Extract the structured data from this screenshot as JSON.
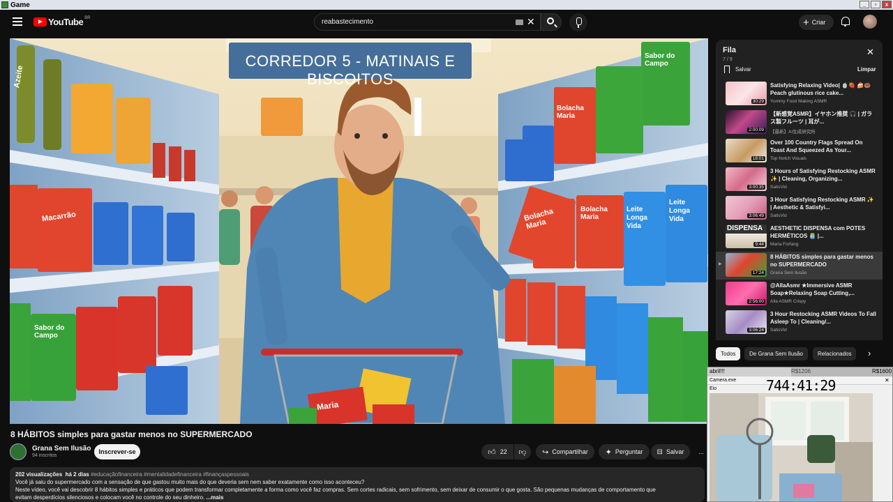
{
  "window": {
    "title": "Game"
  },
  "header": {
    "logo_text": "YouTube",
    "logo_region": "BR",
    "search_query": "reabastecimento",
    "create_label": "Criar",
    "icons": [
      "menu-icon",
      "search-icon",
      "mic-icon",
      "bell-icon",
      "keyboard-icon",
      "clear-icon"
    ]
  },
  "video": {
    "thumbnail_sign": "CORREDOR 5 - MATINAIS E BISCOITOS",
    "title": "8 HÁBITOS simples para gastar menos no SUPERMERCADO",
    "channel": "Grana Sem Ilusão",
    "subscribers": "94 inscritos",
    "subscribe_label": "Inscrever-se",
    "likes": "22",
    "share_label": "Compartilhar",
    "ask_label": "Perguntar",
    "save_label": "Salvar",
    "more_label": "...",
    "product_labels": {
      "azeite": "Azeite",
      "macarrao": "Macarrão",
      "bolacha": "Bolacha Maria",
      "sabor": "Sabor do Campo",
      "leite": "Leite Longa Vida",
      "maria": "Maria"
    }
  },
  "description": {
    "views": "202 visualizações",
    "age": "há 2 dias",
    "tags": "#educaçãofinanceira #mentalidadefinanceira #finançaspessoais",
    "line1": "Você já saiu do supermercado com a sensação de que gastou muito mais do que deveria sem nem saber exatamente como isso aconteceu?",
    "line2": "Neste vídeo, você vai descobrir 8 hábitos simples e práticos que podem transformar completamente a forma como você faz compras. Sem cortes radicais, sem sofrimento, sem deixar de consumir o que gosta. São pequenas mudanças de comportamento que",
    "line3": "evitam desperdícios silenciosos e colocam você no controle do seu dinheiro.",
    "more": "...mais"
  },
  "queue": {
    "title": "Fila",
    "count": "7 / 9",
    "save_label": "Salvar",
    "clear_label": "Limpar",
    "items": [
      {
        "title": "Satisfying Relaxing Video| 🍵🍓 🍰🍩 Peach glutinous rice cake...",
        "channel": "Yummy Food Making ASMR",
        "duration": "30:29",
        "active": false
      },
      {
        "title": "【新感覚ASMR】イヤホン推奨 🎧 | ガラス製フルーツ | 耳が...",
        "channel": "【最新】AI生成研究所",
        "duration": "2:00:09",
        "active": false
      },
      {
        "title": "Over 100 Country Flags Spread On Toast And Squeezed As Your...",
        "channel": "Top Notch Visuals",
        "duration": "18:01",
        "active": false
      },
      {
        "title": "3 Hours of Satisfying Restocking ASMR ✨ | Cleaning, Organizing...",
        "channel": "SatisVid",
        "duration": "3:00:35",
        "active": false
      },
      {
        "title": "3 Hour Satisfying Restocking ASMR ✨ | Aesthetic & Satisfyi...",
        "channel": "SatisVid",
        "duration": "3:06:49",
        "active": false
      },
      {
        "title": "AESTHETIC DISPENSA com POTES HERMÉTICOS 🫙 |...",
        "channel": "Maria Forfang",
        "duration": "9:44",
        "active": false
      },
      {
        "title": "8 HÁBITOS simples para gastar menos no SUPERMERCADO",
        "channel": "Grana Sem Ilusão",
        "duration": "17:24",
        "active": true
      },
      {
        "title": "@AllaAsmr ★Immersive ASMR Soap★Relaxing Soap Cutting,...",
        "channel": "Alla ASMR Crispy",
        "duration": "2:56:00",
        "active": false
      },
      {
        "title": "3 Hour Restocking ASMR Videos To Fall Asleep To | Cleaning/...",
        "channel": "SatisVid",
        "duration": "3:06:24",
        "active": false
      }
    ],
    "thumb_text_dispensa": "DISPENSA"
  },
  "chips": {
    "all": "Todos",
    "channel": "De Grana Sem Ilusão",
    "related": "Relacionados"
  },
  "camera": {
    "goal_left": "abril!!!",
    "goal_mid": "R$1206",
    "goal_right": "R$1600",
    "app_title": "Camera.exe",
    "timer": "744:41:29",
    "label": "Eio"
  },
  "colors": {
    "bg": "#0f0f0f",
    "accent": "#ff0000",
    "panel": "#212121"
  }
}
